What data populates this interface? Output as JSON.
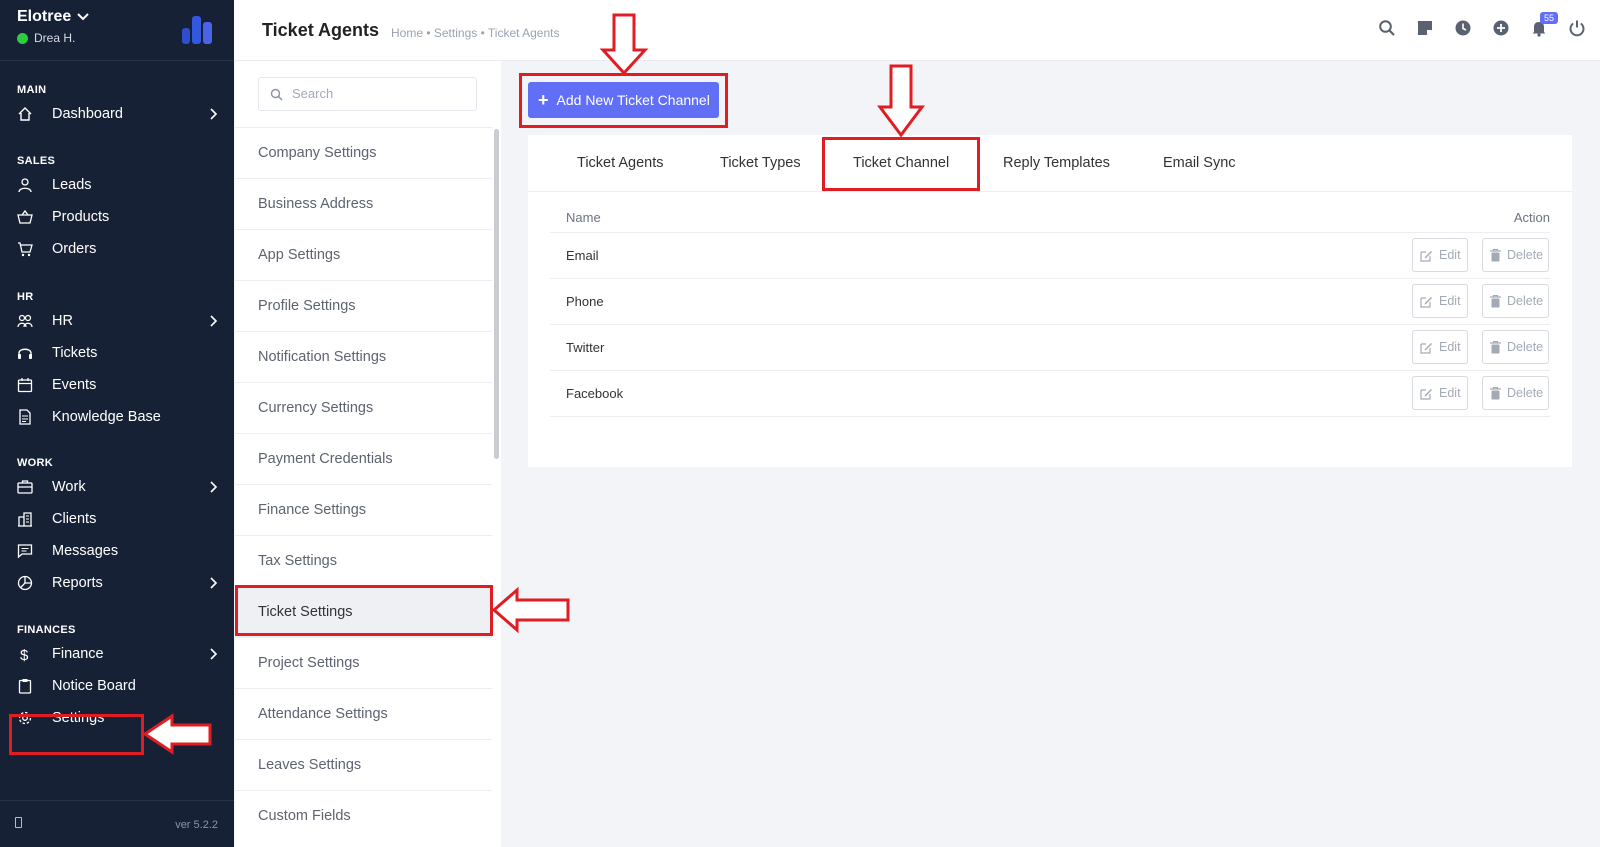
{
  "app": {
    "name": "Elotree",
    "user": "Drea H.",
    "version": "ver 5.2.2"
  },
  "sidebar": {
    "sections": [
      {
        "title": "MAIN",
        "items": [
          {
            "label": "Dashboard",
            "icon": "home-icon",
            "has_children": true
          }
        ]
      },
      {
        "title": "SALES",
        "items": [
          {
            "label": "Leads",
            "icon": "user-icon"
          },
          {
            "label": "Products",
            "icon": "basket-icon"
          },
          {
            "label": "Orders",
            "icon": "cart-icon"
          }
        ]
      },
      {
        "title": "HR",
        "items": [
          {
            "label": "HR",
            "icon": "users-icon",
            "has_children": true
          },
          {
            "label": "Tickets",
            "icon": "headset-icon"
          },
          {
            "label": "Events",
            "icon": "calendar-icon"
          },
          {
            "label": "Knowledge Base",
            "icon": "document-icon"
          }
        ]
      },
      {
        "title": "WORK",
        "items": [
          {
            "label": "Work",
            "icon": "briefcase-icon",
            "has_children": true
          },
          {
            "label": "Clients",
            "icon": "building-icon"
          },
          {
            "label": "Messages",
            "icon": "message-icon"
          },
          {
            "label": "Reports",
            "icon": "pie-chart-icon",
            "has_children": true
          }
        ]
      },
      {
        "title": "FINANCES",
        "items": [
          {
            "label": "Finance",
            "icon": "dollar-icon",
            "has_children": true
          },
          {
            "label": "Notice Board",
            "icon": "clipboard-icon"
          },
          {
            "label": "Settings",
            "icon": "gear-icon",
            "active": true
          }
        ]
      }
    ]
  },
  "header": {
    "title": "Ticket Agents",
    "breadcrumb": "Home • Settings • Ticket Agents",
    "notification_count": "55",
    "icons": [
      "search-icon",
      "sticky-note-icon",
      "clock-icon",
      "plus-circle-icon",
      "bell-icon",
      "power-icon"
    ]
  },
  "settings_menu": {
    "search_placeholder": "Search",
    "items": [
      "Company Settings",
      "Business Address",
      "App Settings",
      "Profile Settings",
      "Notification Settings",
      "Currency Settings",
      "Payment Credentials",
      "Finance Settings",
      "Tax Settings",
      "Ticket Settings",
      "Project Settings",
      "Attendance Settings",
      "Leaves Settings",
      "Custom Fields"
    ],
    "active": "Ticket Settings"
  },
  "main": {
    "add_button": "Add New Ticket Channel",
    "tabs": [
      "Ticket Agents",
      "Ticket Types",
      "Ticket Channel",
      "Reply Templates",
      "Email Sync"
    ],
    "active_tab": "Ticket Channel",
    "table": {
      "columns": [
        "Name",
        "Action"
      ],
      "rows": [
        "Email",
        "Phone",
        "Twitter",
        "Facebook"
      ],
      "edit_label": "Edit",
      "delete_label": "Delete"
    }
  },
  "colors": {
    "sidebar_bg": "#172136",
    "accent": "#616ff7",
    "annotation": "#e11d24"
  }
}
